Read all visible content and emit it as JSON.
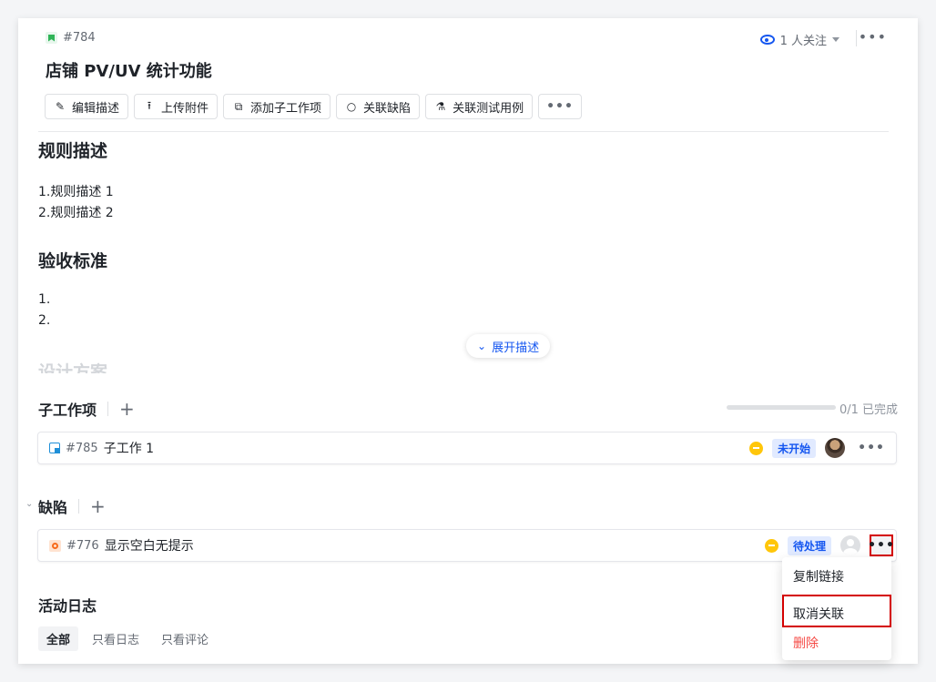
{
  "header": {
    "issue_id": "#784",
    "title": "店铺 PV/UV 统计功能",
    "followers": "1 人关注"
  },
  "toolbar": {
    "edit": "编辑描述",
    "upload": "上传附件",
    "add_sub": "添加子工作项",
    "link_bug": "关联缺陷",
    "link_test": "关联测试用例"
  },
  "description": {
    "rules_title": "规则描述",
    "rules": [
      "1.规则描述 1",
      "2.规则描述 2"
    ],
    "acceptance_title": "验收标准",
    "acceptance": [
      "1.",
      "2."
    ],
    "design_title": "设计方案",
    "expand_label": "展开描述"
  },
  "subtasks": {
    "title": "子工作项",
    "progress_text": "0/1 已完成",
    "progress": 0,
    "items": [
      {
        "id": "#785",
        "name": "子工作 1",
        "status": "未开始"
      }
    ]
  },
  "bugs": {
    "title": "缺陷",
    "items": [
      {
        "id": "#776",
        "name": "显示空白无提示",
        "status": "待处理"
      }
    ]
  },
  "context_menu": {
    "copy_link": "复制链接",
    "unlink": "取消关联",
    "delete": "删除"
  },
  "activity": {
    "title": "活动日志",
    "tabs": [
      "全部",
      "只看日志",
      "只看评论"
    ]
  },
  "colors": {
    "accent": "#1456f0",
    "danger": "#f54a45",
    "highlight": "#d40000"
  }
}
